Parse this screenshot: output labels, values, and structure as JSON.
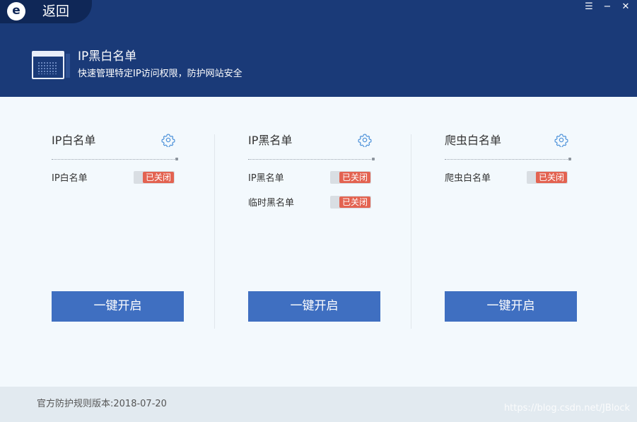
{
  "header": {
    "back_label": "返回",
    "logo_letter": "e",
    "title": "IP黑白名单",
    "subtitle": "快速管理特定IP访问权限，防护网站安全",
    "window_controls": {
      "menu": "☰",
      "minimize": "−",
      "close": "✕"
    }
  },
  "cards": [
    {
      "title": "IP白名单",
      "rows": [
        {
          "label": "IP白名单",
          "status": "已关闭"
        }
      ],
      "button": "一键开启"
    },
    {
      "title": "IP黑名单",
      "rows": [
        {
          "label": "IP黑名单",
          "status": "已关闭"
        },
        {
          "label": "临时黑名单",
          "status": "已关闭"
        }
      ],
      "button": "一键开启"
    },
    {
      "title": "爬虫白名单",
      "rows": [
        {
          "label": "爬虫白名单",
          "status": "已关闭"
        }
      ],
      "button": "一键开启"
    }
  ],
  "footer": {
    "version_text": "官方防护规则版本:2018-07-20",
    "watermark": "https://blog.csdn.net/JBlock"
  },
  "colors": {
    "header_bg": "#1a3a78",
    "accent_button": "#3f6fc1",
    "status_off": "#e36351",
    "gear": "#4a90d9"
  }
}
